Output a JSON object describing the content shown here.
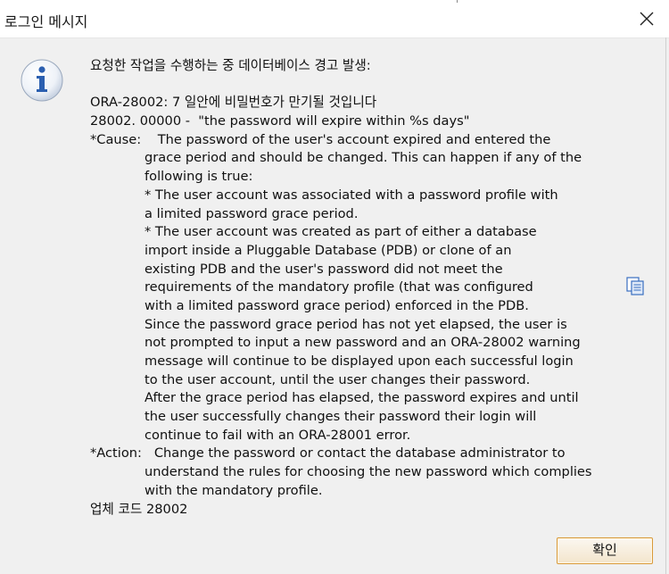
{
  "window": {
    "title": "로그인 메시지"
  },
  "message": {
    "lines": [
      {
        "text": "요청한 작업을 수행하는 중 데이터베이스 경고 발생:",
        "indent": false
      },
      {
        "text": "",
        "indent": false
      },
      {
        "text": "ORA-28002: 7 일안에 비밀번호가 만기될 것입니다",
        "indent": false
      },
      {
        "text": "28002. 00000 -  \"the password will expire within %s days\"",
        "indent": false
      },
      {
        "text": "*Cause:    The password of the user's account expired and entered the",
        "indent": false
      },
      {
        "text": "grace period and should be changed. This can happen if any of the",
        "indent": true
      },
      {
        "text": "following is true:",
        "indent": true
      },
      {
        "text": "* The user account was associated with a password profile with",
        "indent": true
      },
      {
        "text": "a limited password grace period.",
        "indent": true
      },
      {
        "text": "* The user account was created as part of either a database",
        "indent": true
      },
      {
        "text": "import inside a Pluggable Database (PDB) or clone of an",
        "indent": true
      },
      {
        "text": "existing PDB and the user's password did not meet the",
        "indent": true
      },
      {
        "text": "requirements of the mandatory profile (that was configured",
        "indent": true
      },
      {
        "text": "with a limited password grace period) enforced in the PDB.",
        "indent": true
      },
      {
        "text": "Since the password grace period has not yet elapsed, the user is",
        "indent": true
      },
      {
        "text": "not prompted to input a new password and an ORA-28002 warning",
        "indent": true
      },
      {
        "text": "message will continue to be displayed upon each successful login",
        "indent": true
      },
      {
        "text": "to the user account, until the user changes their password.",
        "indent": true
      },
      {
        "text": "After the grace period has elapsed, the password expires and until",
        "indent": true
      },
      {
        "text": "the user successfully changes their password their login will",
        "indent": true
      },
      {
        "text": "continue to fail with an ORA-28001 error.",
        "indent": true
      },
      {
        "text": "*Action:   Change the password or contact the database administrator to",
        "indent": false
      },
      {
        "text": "understand the rules for choosing the new password which complies",
        "indent": true
      },
      {
        "text": "with the mandatory profile.",
        "indent": true
      },
      {
        "text": "업체 코드 28002",
        "indent": false
      }
    ]
  },
  "buttons": {
    "ok_label": "확인"
  },
  "icons": {
    "info": "info-icon",
    "copy": "copy-icon",
    "close": "close-icon"
  },
  "colors": {
    "info_blue": "#2b5fb0",
    "button_border": "#d89a3a",
    "background": "#f0f0f0"
  }
}
